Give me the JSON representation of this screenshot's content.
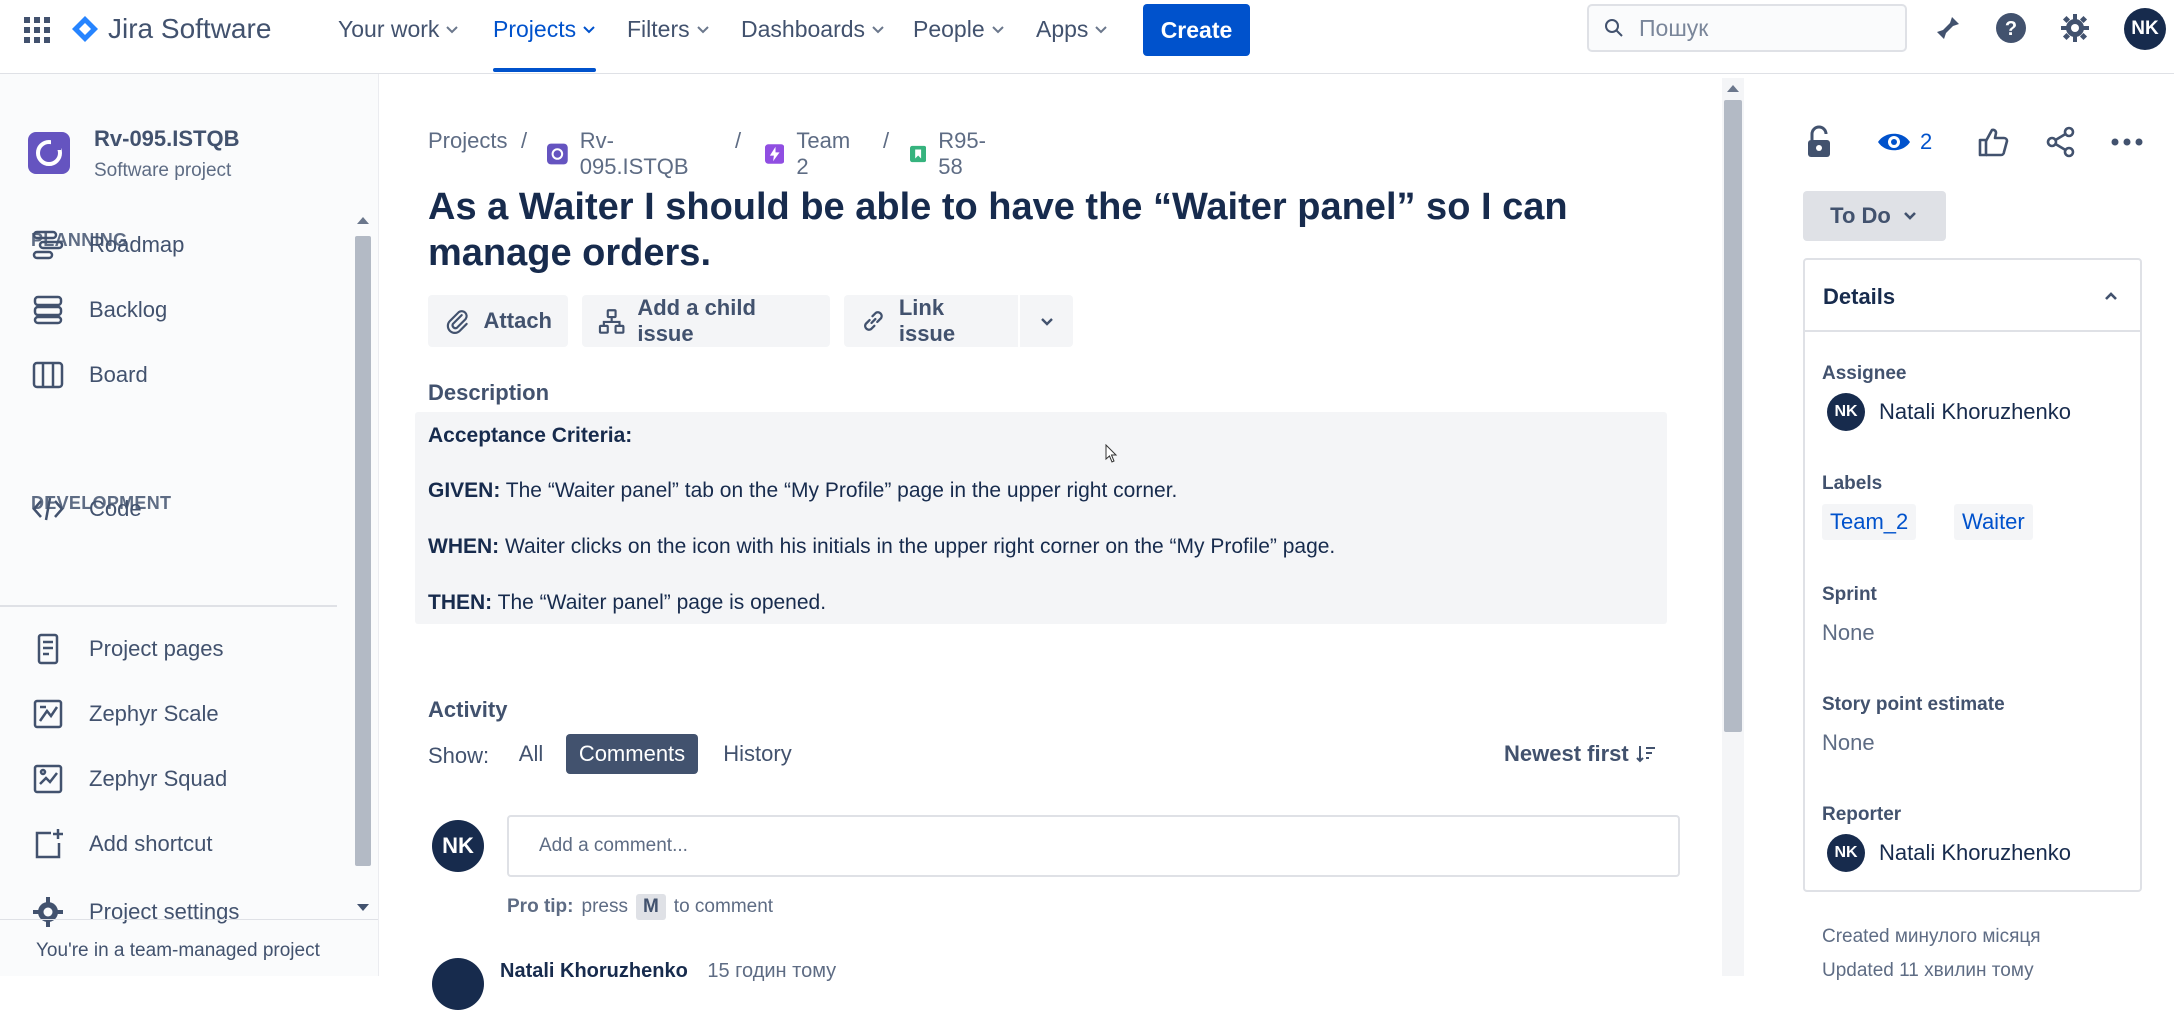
{
  "topnav": {
    "app_name": "Jira Software",
    "items": [
      {
        "label": "Your work"
      },
      {
        "label": "Projects"
      },
      {
        "label": "Filters"
      },
      {
        "label": "Dashboards"
      },
      {
        "label": "People"
      },
      {
        "label": "Apps"
      }
    ],
    "active_item": "Projects",
    "create_label": "Create",
    "search_placeholder": "Пошук",
    "user_initials": "NK"
  },
  "sidebar": {
    "project_name": "Rv-095.ISTQB",
    "project_type": "Software project",
    "planning_heading": "PLANNING",
    "planning_items": [
      {
        "label": "Roadmap",
        "icon": "roadmap-icon"
      },
      {
        "label": "Backlog",
        "icon": "backlog-icon"
      },
      {
        "label": "Board",
        "icon": "board-icon"
      }
    ],
    "development_heading": "DEVELOPMENT",
    "development_items": [
      {
        "label": "Code",
        "icon": "code-icon"
      }
    ],
    "other_items": [
      {
        "label": "Project pages",
        "icon": "page-icon"
      },
      {
        "label": "Zephyr Scale",
        "icon": "zephyr-scale-icon"
      },
      {
        "label": "Zephyr Squad",
        "icon": "zephyr-squad-icon"
      },
      {
        "label": "Add shortcut",
        "icon": "add-shortcut-icon"
      },
      {
        "label": "Project settings",
        "icon": "gear-icon"
      }
    ],
    "footer": "You're in a team-managed project"
  },
  "breadcrumb": {
    "items": [
      {
        "label": "Projects"
      },
      {
        "label": "Rv-095.ISTQB"
      },
      {
        "label": "Team 2"
      },
      {
        "label": "R95-58"
      }
    ],
    "separator": "/"
  },
  "issue": {
    "title": "As a Waiter I should be able to have the “Waiter panel” so I can manage orders.",
    "actions": {
      "attach": "Attach",
      "add_child": "Add a child issue",
      "link": "Link issue"
    },
    "description_label": "Description",
    "description": {
      "heading": "Acceptance Criteria:",
      "given_key": "GIVEN:",
      "given_text": " The “Waiter panel” tab on the “My Profile” page in the upper right corner.",
      "when_key": "WHEN:",
      "when_text": "Waiter clicks on the icon with his initials in the upper right corner on the “My Profile” page.",
      "then_key": "THEN:",
      "then_text": "The “Waiter panel” page is opened."
    }
  },
  "activity": {
    "label": "Activity",
    "show_label": "Show:",
    "filters": [
      {
        "label": "All"
      },
      {
        "label": "Comments"
      },
      {
        "label": "History"
      }
    ],
    "active_filter": "Comments",
    "sort_label": "Newest first",
    "comment_avatar": "NK",
    "comment_placeholder": "Add a comment...",
    "protip_prefix": "Pro tip:",
    "protip_press": "press",
    "protip_key": "M",
    "protip_suffix": "to comment",
    "partial_comment_author": "Natali Khoruzhenko",
    "partial_comment_time": "15 годин тому"
  },
  "rightpanel": {
    "watch_count": "2",
    "status": "To Do",
    "details_title": "Details",
    "assignee_label": "Assignee",
    "assignee": "Natali Khoruzhenko",
    "assignee_initials": "NK",
    "labels_label": "Labels",
    "labels": [
      "Team_2",
      "Waiter"
    ],
    "sprint_label": "Sprint",
    "sprint_value": "None",
    "story_points_label": "Story point estimate",
    "story_points_value": "None",
    "reporter_label": "Reporter",
    "reporter": "Natali Khoruzhenko",
    "reporter_initials": "NK",
    "created": "Created минулого місяця",
    "updated": "Updated 11 хвилин тому"
  },
  "colors": {
    "brand": "#0052cc",
    "text": "#172b4d",
    "subtle": "#5e6c84"
  }
}
